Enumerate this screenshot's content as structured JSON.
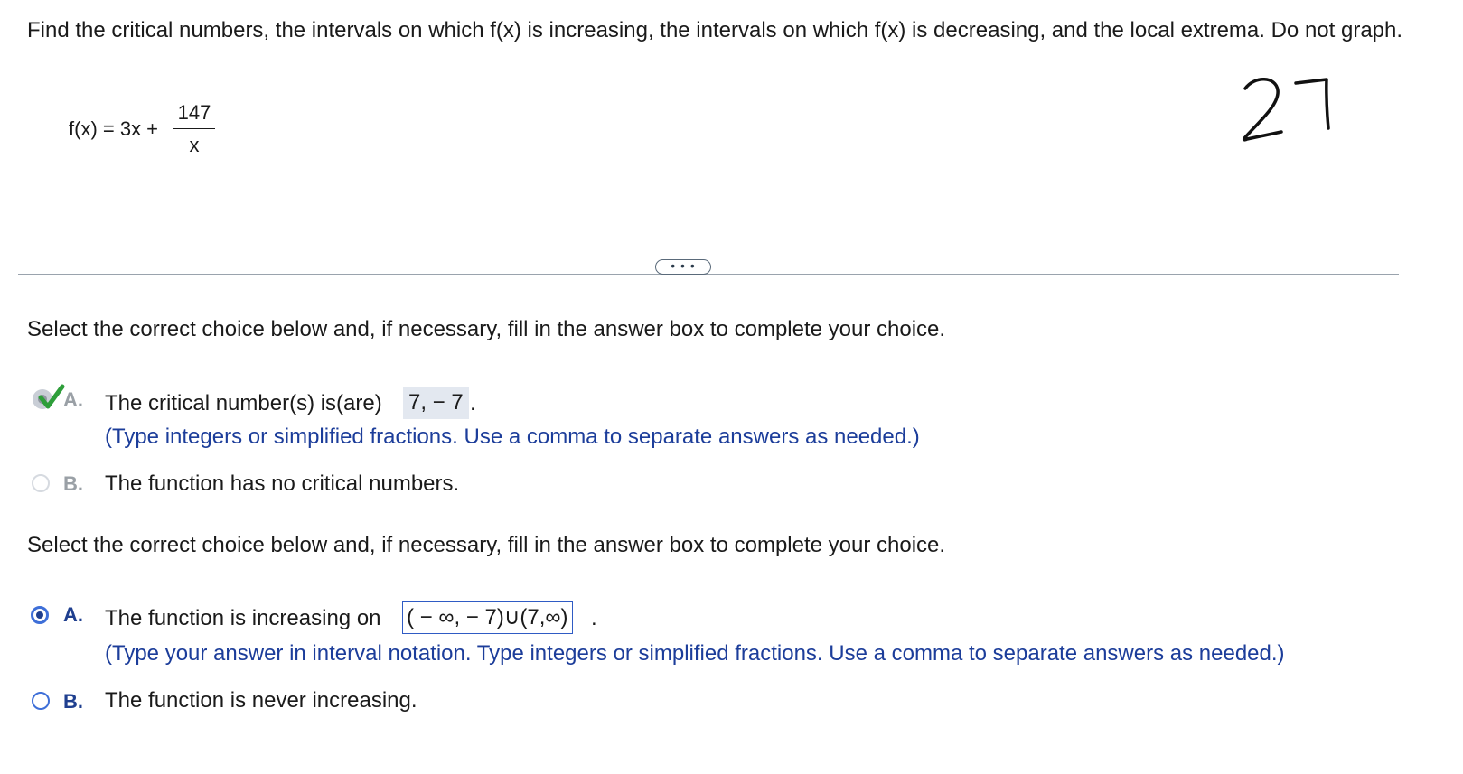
{
  "problem": {
    "prompt": "Find the critical numbers, the intervals on which f(x) is increasing, the intervals on which f(x) is decreasing, and the local extrema. Do not graph.",
    "function_lhs": "f(x) = 3x +",
    "numerator": "147",
    "denominator": "x",
    "handwritten_note": "27"
  },
  "toolbar": {
    "more_label": "• • •"
  },
  "part1": {
    "instruction": "Select the correct choice below and, if necessary, fill in the answer box to complete your choice.",
    "choice_a": {
      "letter": "A.",
      "text_before": "The critical number(s) is(are)",
      "answer": "7, − 7",
      "text_after": ".",
      "hint": "(Type integers or simplified fractions. Use a comma to separate answers as needed.)",
      "status": "correct"
    },
    "choice_b": {
      "letter": "B.",
      "text": "The function has no critical numbers."
    }
  },
  "part2": {
    "instruction": "Select the correct choice below and, if necessary, fill in the answer box to complete your choice.",
    "choice_a": {
      "letter": "A.",
      "text_before": "The function is increasing on",
      "answer": "( − ∞, − 7)∪(7,∞)",
      "text_after": ".",
      "hint": "(Type your answer in interval notation. Type integers or simplified fractions. Use a comma to separate answers as needed.)",
      "selected": true
    },
    "choice_b": {
      "letter": "B.",
      "text": "The function is never increasing."
    }
  },
  "colors": {
    "accent_blue": "#1f3f8f",
    "hint_blue": "#1c3d9a",
    "correct_green": "#2e9e3a",
    "answer_shade": "#e3e8f0"
  }
}
